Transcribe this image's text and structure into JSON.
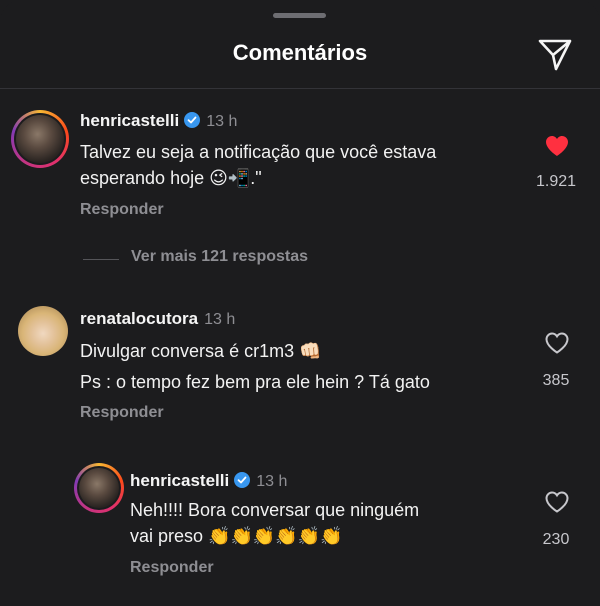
{
  "header": {
    "title": "Comentários",
    "send_icon": "paper-plane-icon"
  },
  "colors": {
    "background": "#1c1c1e",
    "liked_heart": "#ff3040",
    "verified_badge": "#3897f0",
    "secondary_text": "#8e8e93"
  },
  "comments": [
    {
      "username": "henricastelli",
      "verified": true,
      "time": "13 h",
      "lines": [
        "Talvez eu seja a notificação que você estava",
        "esperando hoje 😉📲.\""
      ],
      "reply_label": "Responder",
      "liked": true,
      "like_count": "1.921",
      "view_replies": "Ver mais 121 respostas"
    },
    {
      "username": "renatalocutora",
      "verified": false,
      "time": "13 h",
      "lines": [
        "Divulgar conversa é cr1m3 👊🏻",
        "Ps : o tempo fez bem pra ele hein ? Tá gato"
      ],
      "reply_label": "Responder",
      "liked": false,
      "like_count": "385",
      "replies": [
        {
          "username": "henricastelli",
          "verified": true,
          "time": "13 h",
          "lines": [
            "Neh!!!! Bora conversar que ninguém",
            "vai preso 👏👏👏👏👏👏"
          ],
          "reply_label": "Responder",
          "liked": false,
          "like_count": "230"
        }
      ]
    }
  ]
}
